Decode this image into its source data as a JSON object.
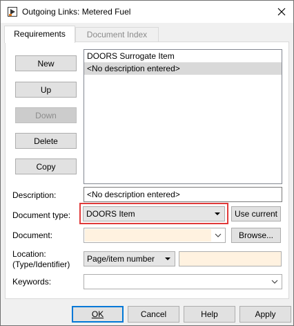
{
  "window": {
    "title": "Outgoing Links: Metered Fuel"
  },
  "tabs": [
    {
      "label": "Requirements",
      "active": true
    },
    {
      "label": "Document Index",
      "active": false
    }
  ],
  "side_buttons": {
    "new": "New",
    "up": "Up",
    "down": "Down",
    "delete": "Delete",
    "copy": "Copy"
  },
  "requirements_list": [
    {
      "text": "DOORS Surrogate Item",
      "selected": false
    },
    {
      "text": "<No description entered>",
      "selected": true
    }
  ],
  "form": {
    "description_label": "Description:",
    "description_value": "<No description entered>",
    "document_type_label": "Document type:",
    "document_type_value": "DOORS Item",
    "use_current_label": "Use current",
    "document_label": "Document:",
    "document_value": "",
    "browse_label": "Browse...",
    "location_label_line1": "Location:",
    "location_label_line2": "(Type/Identifier)",
    "location_type_value": "Page/item number",
    "location_identifier_value": "",
    "keywords_label": "Keywords:",
    "keywords_value": ""
  },
  "dialog_buttons": {
    "ok": "OK",
    "cancel": "Cancel",
    "help": "Help",
    "apply": "Apply"
  },
  "colors": {
    "highlight": "#e03a3a",
    "default_button_border": "#0078d7",
    "required_field_fill": "#fff2e0"
  }
}
